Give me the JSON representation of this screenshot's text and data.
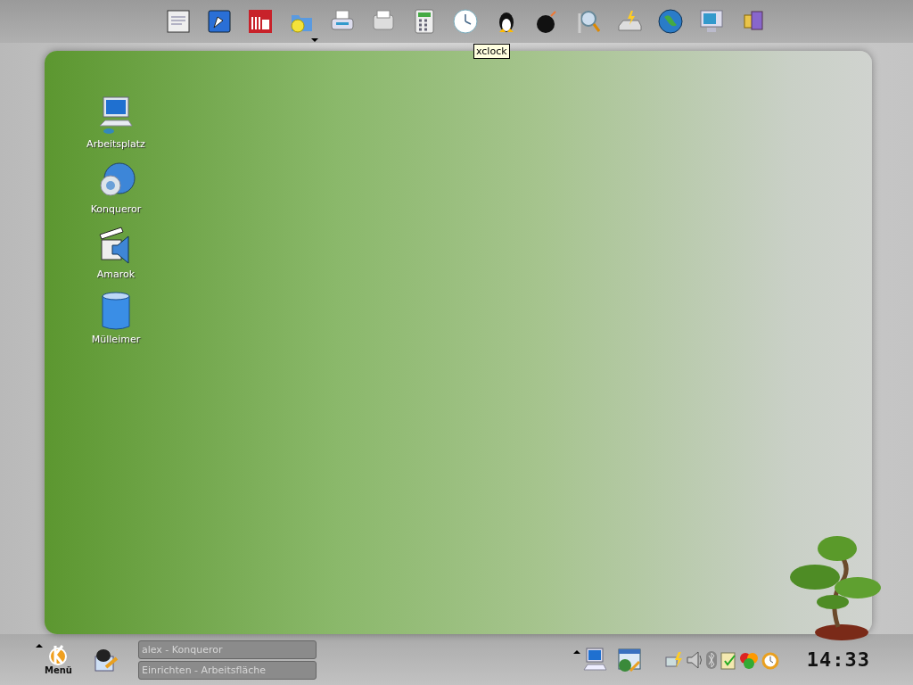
{
  "toolbar": {
    "tooltip": "xclock"
  },
  "desktop_icons": [
    {
      "label": "Arbeitsplatz",
      "kind": "computer"
    },
    {
      "label": "Konqueror",
      "kind": "globe"
    },
    {
      "label": "Amarok",
      "kind": "media"
    },
    {
      "label": "Mülleimer",
      "kind": "trash"
    }
  ],
  "panel": {
    "menu_label": "Menü",
    "tasks": [
      {
        "title": "alex - Konqueror"
      },
      {
        "title": "Einrichten - Arbeitsfläche"
      }
    ],
    "clock": "14:33"
  }
}
